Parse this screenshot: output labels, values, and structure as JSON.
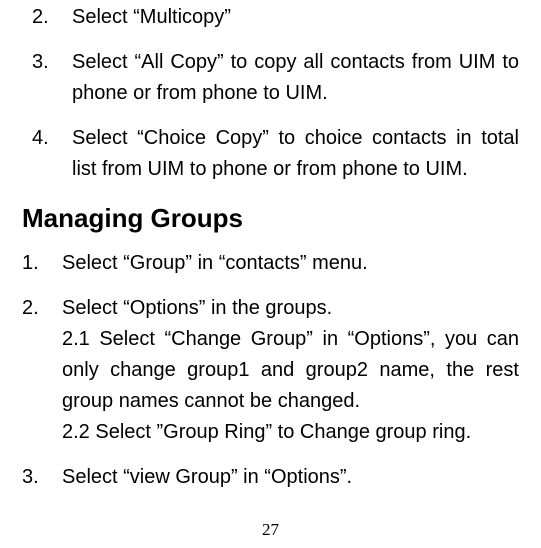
{
  "list1": {
    "items": [
      {
        "num": "2.",
        "text": "Select “Multicopy”"
      },
      {
        "num": "3.",
        "text": "Select “All Copy” to copy all contacts from UIM to phone or from phone to UIM."
      },
      {
        "num": "4.",
        "text": "Select “Choice Copy” to choice contacts in total list from UIM to phone or from phone to UIM."
      }
    ]
  },
  "heading": "Managing Groups",
  "list2": {
    "items": [
      {
        "num": "1.",
        "text": "Select “Group” in “contacts” menu."
      },
      {
        "num": "2.",
        "text": "Select “Options” in the groups.",
        "subs": [
          "2.1 Select “Change Group” in “Options”, you can only change group1 and group2 name, the rest group names cannot be changed.",
          "2.2 Select ”Group Ring” to Change group ring."
        ]
      },
      {
        "num": "3.",
        "text": "Select “view Group” in “Options”."
      }
    ]
  },
  "page_number": "27"
}
